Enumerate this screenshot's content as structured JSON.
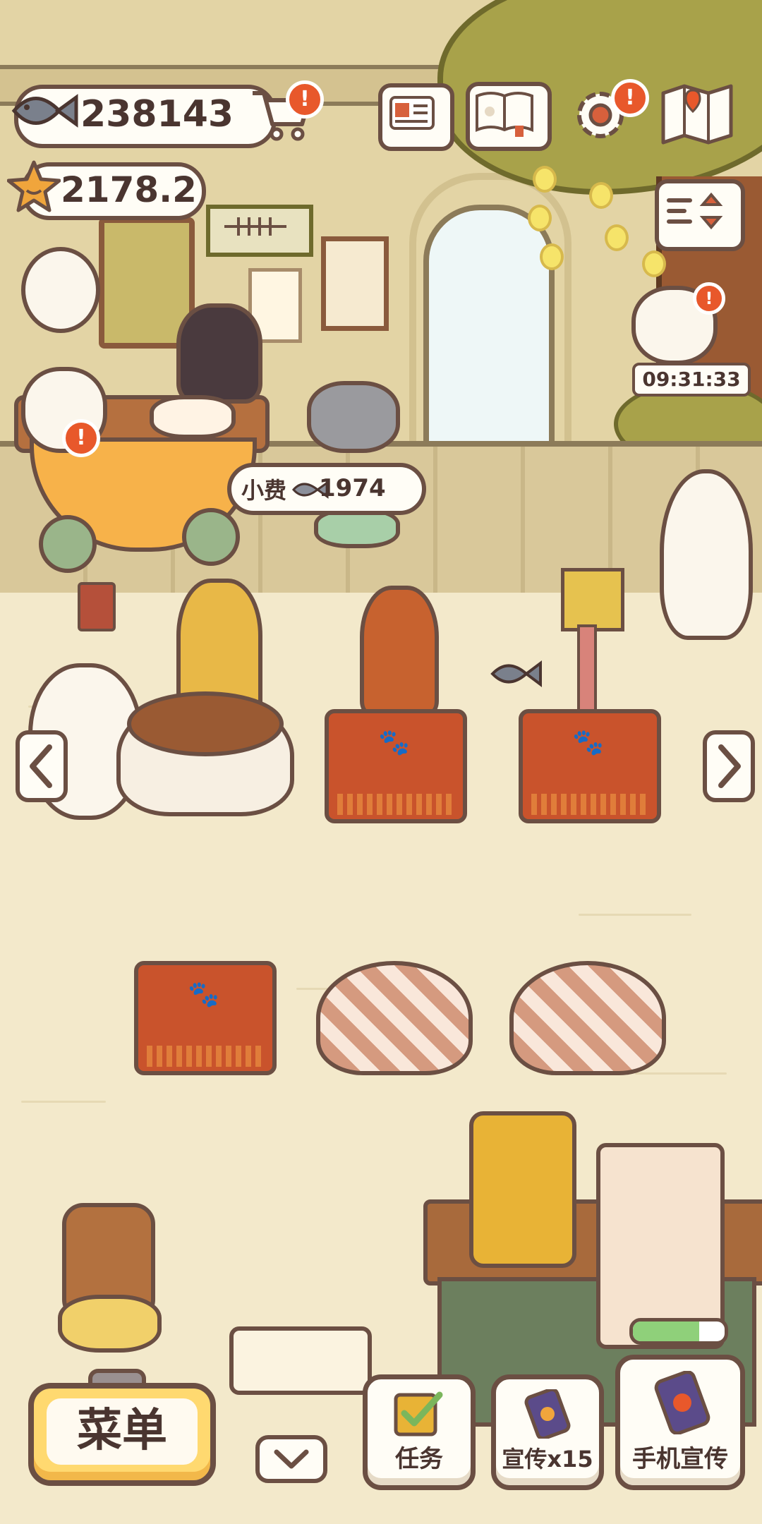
{
  "currency": {
    "fish": "238143",
    "star": "2178.2"
  },
  "tip": {
    "label": "小费",
    "amount": "1974"
  },
  "timer": "09:31:33",
  "buttons": {
    "menu": "菜单",
    "tasks": "任务",
    "promote": "宣传x15",
    "phone_promote": "手机宣传"
  },
  "icons": {
    "fish": "fish-icon",
    "star": "star-icon",
    "cart": "cart-icon",
    "id_card": "id-card-icon",
    "paw_book": "paw-book-icon",
    "settings": "gear-icon",
    "map": "map-icon",
    "sort": "sort-icon",
    "alert": "alert-icon",
    "left_arrow": "chevron-left-icon",
    "right_arrow": "chevron-right-icon",
    "down_arrow": "chevron-down-icon",
    "task": "checkbox-icon",
    "phone": "phone-icon"
  },
  "colors": {
    "accent": "#ffd970",
    "alert": "#e8582b",
    "outline": "#6b4f43",
    "progress": "#8fd07a"
  },
  "progress": {
    "machine_fill": 0.72
  }
}
